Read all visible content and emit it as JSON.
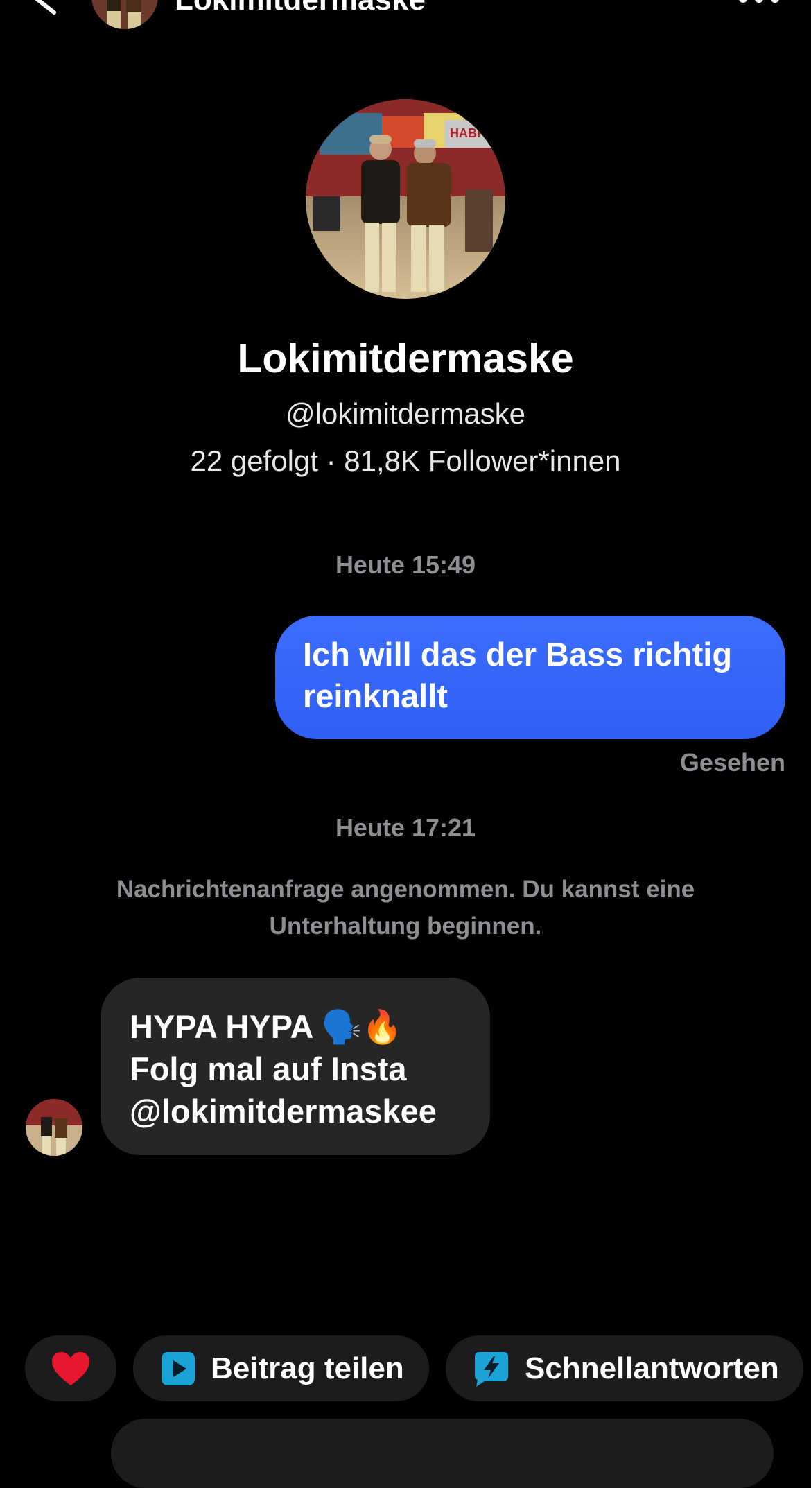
{
  "header": {
    "title": "Lokimitdermaske"
  },
  "profile": {
    "name": "Lokimitdermaske",
    "handle": "@lokimitdermaske",
    "stats": "22 gefolgt · 81,8K Follower*innen"
  },
  "chat": {
    "timestamp_1": "Heute 15:49",
    "outgoing_message": "Ich will das der Bass richtig reinknallt",
    "seen_label": "Gesehen",
    "timestamp_2": "Heute 17:21",
    "system_note": "Nachrichtenanfrage angenommen. Du kannst eine Unterhaltung beginnen.",
    "incoming_message": {
      "line_1": "HYPA HYPA 🗣️🔥",
      "line_2": "Folg mal auf Insta",
      "line_3": "@lokimitdermaskee"
    }
  },
  "quick_actions": {
    "heart_icon": "heart-icon",
    "share_label": "Beitrag teilen",
    "share_icon": "play-square-icon",
    "quick_replies_label": "Schnellantworten",
    "quick_replies_icon": "lightning-bubble-icon"
  },
  "colors": {
    "outgoing_bubble": "#3c6dfb",
    "incoming_bubble": "#262626",
    "chip_background": "#1c1c1e",
    "muted_text": "#8e8e93",
    "heart": "#e8162e",
    "share_icon": "#1aa3d6"
  }
}
